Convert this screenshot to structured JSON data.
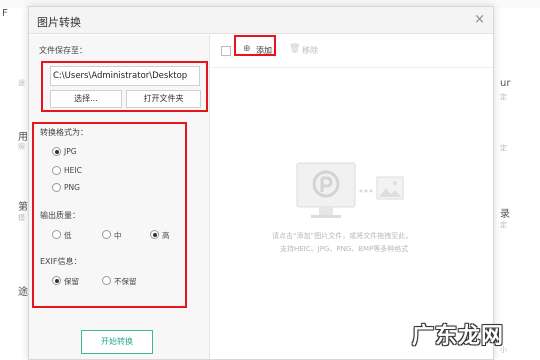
{
  "background": {
    "left_fragments": [
      "F",
      "途",
      "频",
      "用",
      "照",
      "第",
      "模",
      "途"
    ],
    "right_fragments": [
      "ur",
      "定",
      "定",
      "录",
      "定",
      "模",
      "小"
    ]
  },
  "dialog": {
    "title": "图片转换",
    "close_glyph": "×"
  },
  "left_panel": {
    "save_to_label": "文件保存至：",
    "save_path": "C:\\Users\\Administrator\\Desktop",
    "choose_button": "选择...",
    "open_folder_button": "打开文件夹",
    "format_label": "转换格式为：",
    "formats": [
      "JPG",
      "HEIC",
      "PNG"
    ],
    "selected_format": "JPG",
    "quality_label": "输出质量：",
    "qualities": [
      "低",
      "中",
      "高"
    ],
    "selected_quality": "高",
    "exif_label": "EXIF信息：",
    "exif_options": [
      "保留",
      "不保留"
    ],
    "selected_exif": "保留",
    "start_button": "开始转换"
  },
  "toolbar": {
    "add_label": "添加",
    "remove_label": "移除"
  },
  "drop_area": {
    "hint_line1": "请点击“添加”图片文件，或将文件拖拽至此，",
    "hint_line2": "支持HEIC、JPG、PNG、BMP等多种格式"
  },
  "watermark": "广东龙网",
  "colors": {
    "highlight_red": "#e8141b",
    "accent_teal": "#2fa88f"
  }
}
